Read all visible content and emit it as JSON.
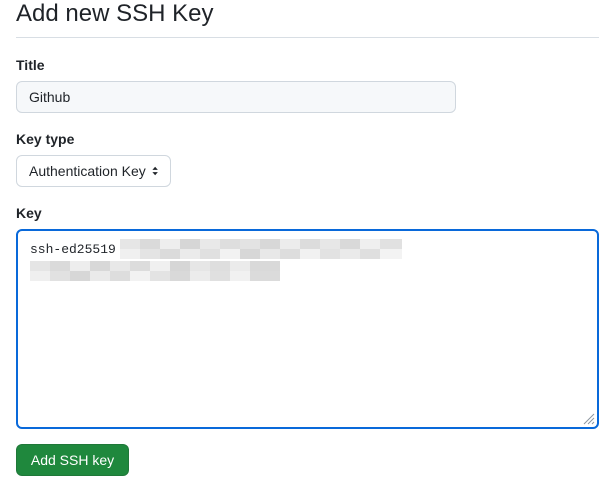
{
  "page": {
    "title": "Add new SSH Key"
  },
  "form": {
    "title_field": {
      "label": "Title",
      "value": "Github"
    },
    "key_type": {
      "label": "Key type",
      "selected": "Authentication Key"
    },
    "key_field": {
      "label": "Key",
      "value_prefix": "ssh-ed25519",
      "redacted": true
    },
    "submit_label": "Add SSH key"
  },
  "colors": {
    "accent": "#0969da",
    "primary_button": "#1f883d",
    "input_background": "#f6f8fa",
    "border": "#d0d7de"
  },
  "icons": {
    "select_caret": "select-caret-icon",
    "resize_grip": "resize-grip-icon"
  }
}
